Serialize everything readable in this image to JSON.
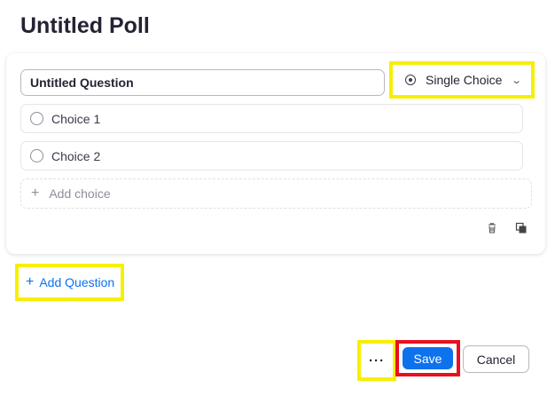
{
  "poll": {
    "title": "Untitled Poll"
  },
  "question": {
    "value": "Untitled Question",
    "type_label": "Single Choice",
    "choices": [
      "Choice 1",
      "Choice 2"
    ],
    "add_choice_label": "Add choice"
  },
  "actions": {
    "add_question_label": "Add Question",
    "more_label": "···",
    "save_label": "Save",
    "cancel_label": "Cancel"
  },
  "icons": {
    "add_choice": "plus-icon",
    "add_question": "plus-icon",
    "delete": "trash-icon",
    "duplicate": "copy-icon",
    "type": "radio-icon",
    "dropdown": "chevron-down-icon"
  },
  "colors": {
    "accent": "#0e72ed",
    "highlight_yellow": "#f7ef00",
    "highlight_red": "#e8101f"
  }
}
